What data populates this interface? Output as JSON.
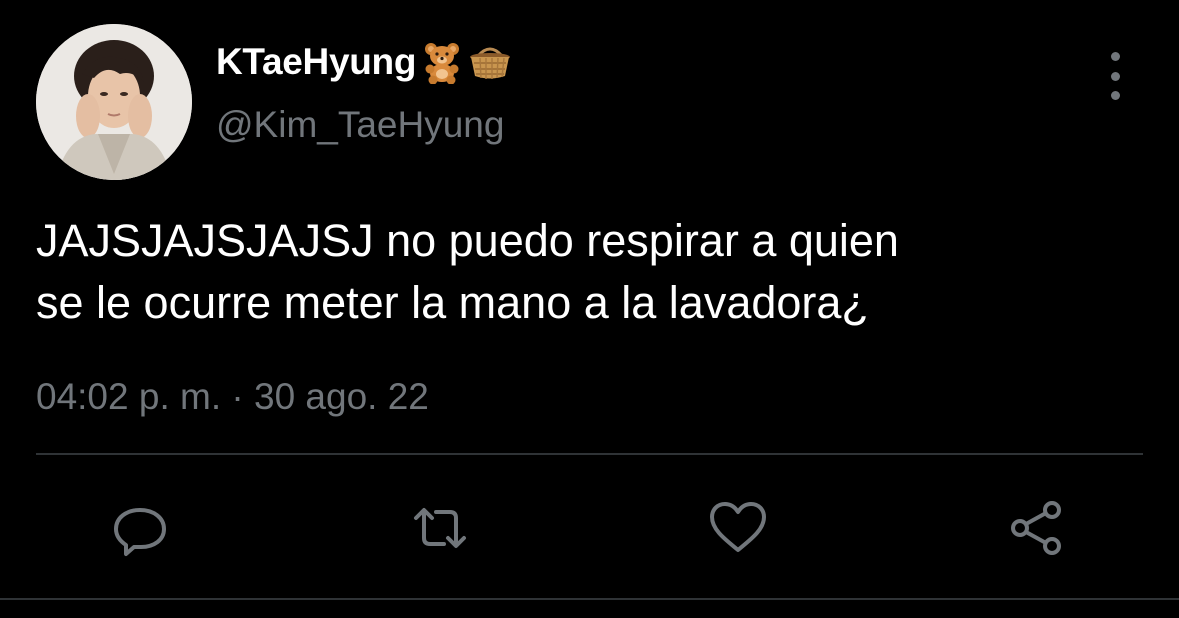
{
  "tweet": {
    "author": {
      "display_name": "KTaeHyung",
      "handle": "@Kim_TaeHyung",
      "name_emojis": [
        "teddy-bear-emoji",
        "basket-emoji"
      ]
    },
    "text": "JAJSJAJSJAJSJ no puedo respirar a quien\nse le ocurre meter la mano a la lavadora¿",
    "timestamp": "04:02 p. m. · 30 ago. 22"
  },
  "actions": [
    "reply-icon",
    "retweet-icon",
    "like-icon",
    "share-icon"
  ],
  "colors": {
    "background": "#000000",
    "primary_text": "#ffffff",
    "secondary_text": "#71767b",
    "divider": "#2f3336"
  }
}
